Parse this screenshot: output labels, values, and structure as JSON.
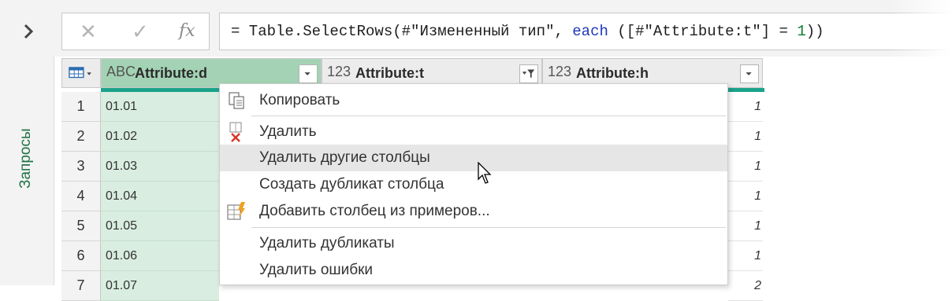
{
  "sidebar": {
    "label": "Запросы"
  },
  "formula_bar": {
    "cancel_symbol": "✕",
    "confirm_symbol": "✓",
    "fx_symbol": "fx",
    "prefix": "= Table.SelectRows(#\"Измененный тип\", ",
    "keyword": "each",
    "middle": " ([#\"Attribute:t\"] = ",
    "number": "1",
    "suffix": "))"
  },
  "table": {
    "columns": [
      {
        "type_icon": "ABC",
        "name": "Attribute:d"
      },
      {
        "type_icon": "123",
        "name": "Attribute:t"
      },
      {
        "type_icon": "123",
        "name": "Attribute:h"
      }
    ],
    "row_numbers": [
      "1",
      "2",
      "3",
      "4",
      "5",
      "6",
      "7"
    ],
    "col_d_values": [
      "01.01",
      "01.02",
      "01.03",
      "01.04",
      "01.05",
      "01.06",
      "01.07"
    ],
    "col_h_values": [
      "1",
      "1",
      "1",
      "1",
      "1",
      "1",
      "2"
    ]
  },
  "context_menu": {
    "items": [
      {
        "label": "Копировать",
        "icon": "copy-icon"
      },
      {
        "label": "Удалить",
        "icon": "delete-column-icon"
      },
      {
        "label": "Удалить другие столбцы",
        "icon": ""
      },
      {
        "label": "Создать дубликат столбца",
        "icon": ""
      },
      {
        "label": "Добавить столбец из примеров...",
        "icon": "add-column-from-examples-icon"
      },
      {
        "label": "Удалить дубликаты",
        "icon": ""
      },
      {
        "label": "Удалить ошибки",
        "icon": ""
      }
    ],
    "highlighted_index": 2
  },
  "colors": {
    "accent_green": "#217346",
    "selected_header": "#a3d3b4",
    "selected_col_bg": "#d9ede1",
    "teal_bar": "#1aa38a",
    "keyword_blue": "#1f38b8",
    "number_green": "#0a7d2c"
  }
}
